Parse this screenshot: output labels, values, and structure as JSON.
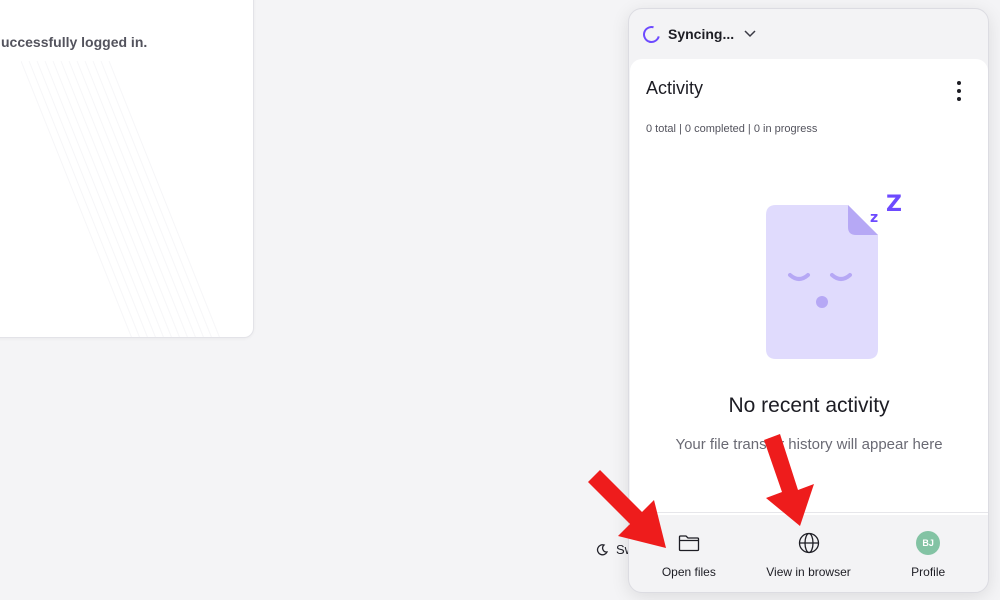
{
  "background": {
    "card_message": "uccessfully logged in.",
    "theme_switch_label": "Sw"
  },
  "widget": {
    "sync_status": "Syncing...",
    "activity": {
      "title": "Activity",
      "counts": "0 total | 0 completed | 0 in progress",
      "empty_title": "No recent activity",
      "empty_subtitle": "Your file transfer history will appear here"
    },
    "nav": {
      "open_files": "Open files",
      "view_in_browser": "View in browser",
      "profile": "Profile",
      "profile_initials": "BJ"
    }
  },
  "colors": {
    "accent": "#6d4aff",
    "illustration": "#e0dbfd",
    "avatar": "#83c3a4",
    "annotation_arrow": "#ee1c1c"
  }
}
